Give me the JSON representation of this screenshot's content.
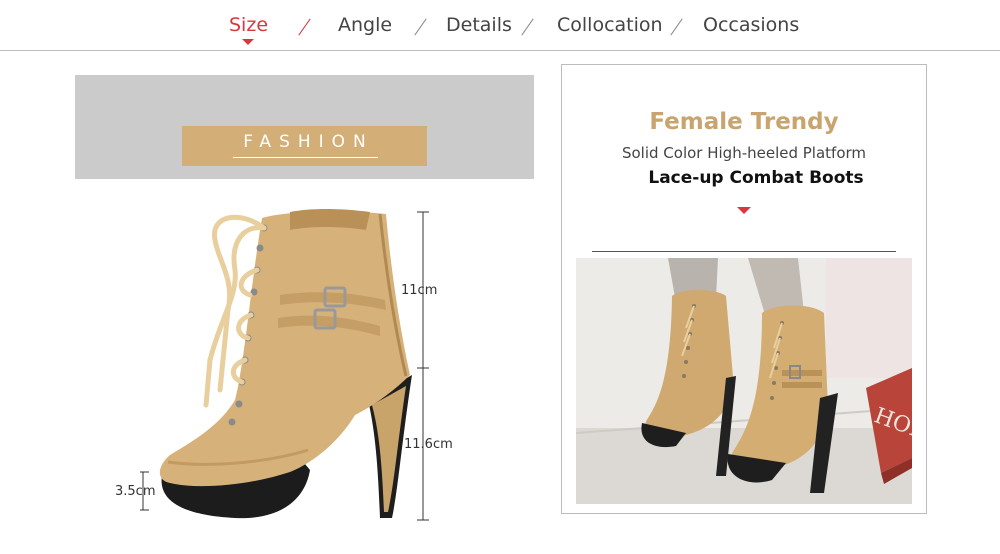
{
  "nav": {
    "tabs": [
      {
        "label": "Size",
        "active": true
      },
      {
        "label": "Angle",
        "active": false
      },
      {
        "label": "Details",
        "active": false
      },
      {
        "label": "Collocation",
        "active": false
      },
      {
        "label": "Occasions",
        "active": false
      }
    ]
  },
  "banner": {
    "label": "FASHION"
  },
  "dimensions": {
    "shaft_height": "11cm",
    "heel_height": "11.6cm",
    "platform_height": "3.5cm"
  },
  "product": {
    "headline": "Female Trendy",
    "subtitle": "Solid Color High-heeled Platform",
    "name": "Lace-up Combat Boots",
    "photo_box_text": "HOM"
  },
  "colors": {
    "accent_red": "#d9363e",
    "tan": "#d3ae76",
    "headline_gold": "#c9a46e",
    "banner_gray": "#cbcbcb"
  }
}
